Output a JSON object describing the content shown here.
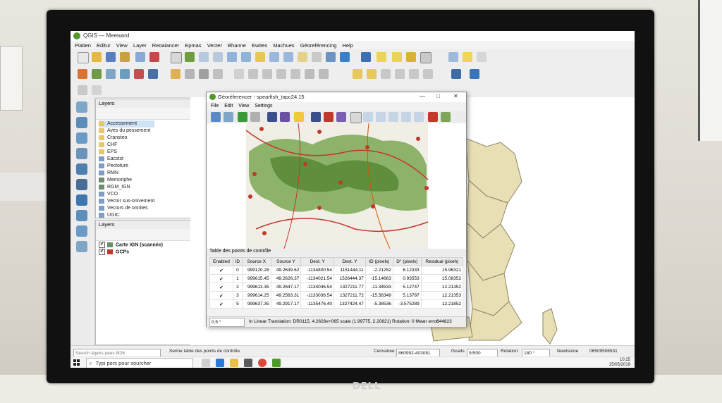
{
  "app": {
    "title": "QGIS — Meeward",
    "menu": [
      "Piatien",
      "Editur",
      "View",
      "Layer",
      "Reoaiancer",
      "Epmas",
      "Vecter",
      "Bhanne",
      "Ewites",
      "Machues",
      "Géoreférencing",
      "Help"
    ]
  },
  "layers_panel": {
    "title": "Layers",
    "items": [
      {
        "label": "Accessement",
        "type": "folder",
        "selected": true
      },
      {
        "label": "Aves du pessement",
        "type": "folder"
      },
      {
        "label": "Cransteo",
        "type": "folder"
      },
      {
        "label": "CHF",
        "type": "folder"
      },
      {
        "label": "EPS",
        "type": "folder"
      },
      {
        "label": "Eacstst",
        "type": "vector"
      },
      {
        "label": "Pectoture",
        "type": "vector"
      },
      {
        "label": "RMN",
        "type": "vector"
      },
      {
        "label": "Memoriphe",
        "type": "raster"
      },
      {
        "label": "RGM_IGN",
        "type": "raster"
      },
      {
        "label": "VCO",
        "type": "vector"
      },
      {
        "label": "Vector sus-onivement",
        "type": "vector"
      },
      {
        "label": "Vectors de onnites",
        "type": "vector"
      },
      {
        "label": "UGIC",
        "type": "vector"
      }
    ]
  },
  "layers_panel2": {
    "title": "Layers",
    "items": [
      {
        "label": "Carte IGN (scannée)",
        "checked": true
      },
      {
        "label": "GCPs",
        "checked": true
      }
    ]
  },
  "georef": {
    "title": "Géoréferencer - spearfish_tapc24.15",
    "menu": [
      "File",
      "Edit",
      "View",
      "Settings"
    ],
    "table_title": "Table des points de contrôle",
    "columns": [
      "Enabled",
      "ID",
      "Source X",
      "Source Y",
      "Dest. Y",
      "Dest. Y",
      "ID (pixels)",
      "D° (pixels)",
      "Residual (pixeh)"
    ],
    "rows": [
      [
        "✔",
        "0",
        "999120.28",
        "49.2639.62",
        "-1134800.54",
        "1151444.11",
        "-2.21252",
        "6.12333",
        "15.96321"
      ],
      [
        "✔",
        "1",
        "999615.45",
        "49.2626.37",
        "-1134021.54",
        "1526444.37",
        "-15.14663",
        "0.93553",
        "15.08352"
      ],
      [
        "✔",
        "2",
        "999613.35",
        "49.2647.17",
        "-1134046.54",
        "1327211.77",
        "-11.34533",
        "5.12747",
        "12.21352"
      ],
      [
        "✔",
        "3",
        "999614.25",
        "49.2583.31",
        "-1133036.54",
        "1327211.72",
        "-15.58349",
        "5.13787",
        "12.21353"
      ],
      [
        "✔",
        "5",
        "999637.35",
        "49.2917.17",
        "-1135476.40",
        "1327424.47",
        "-5.38536",
        "-3.575289",
        "12.21852"
      ]
    ],
    "status_zoom": "0.5 °",
    "status_text": "In Linear Translation: DR0115, 4.2626e+065 scale (1.99775, 2.20821) Rotation: 0 Mean error:",
    "status_error": "644823"
  },
  "statusbar": {
    "search_placeholder": "Search layers pees 8t26",
    "message": "Serine table des points de contrôle",
    "coordinate_label": "Cenvairee:",
    "coordinate": "860992-403081",
    "scale_label": "Gcads",
    "scale": "5r500",
    "rotation_label": "Rotation:",
    "rotation": "180 °",
    "render_label": "Nexitsione",
    "epsg": "06509506531"
  },
  "taskbar": {
    "search": "Typi pers pour sourcher",
    "time": "10:25",
    "date": "25/05/2019"
  },
  "monitor_brand": "DELL",
  "colors": {
    "qgis_green": "#4e9a28",
    "selection": "#cfe3f7",
    "region_fill": "#e8dfb5"
  }
}
